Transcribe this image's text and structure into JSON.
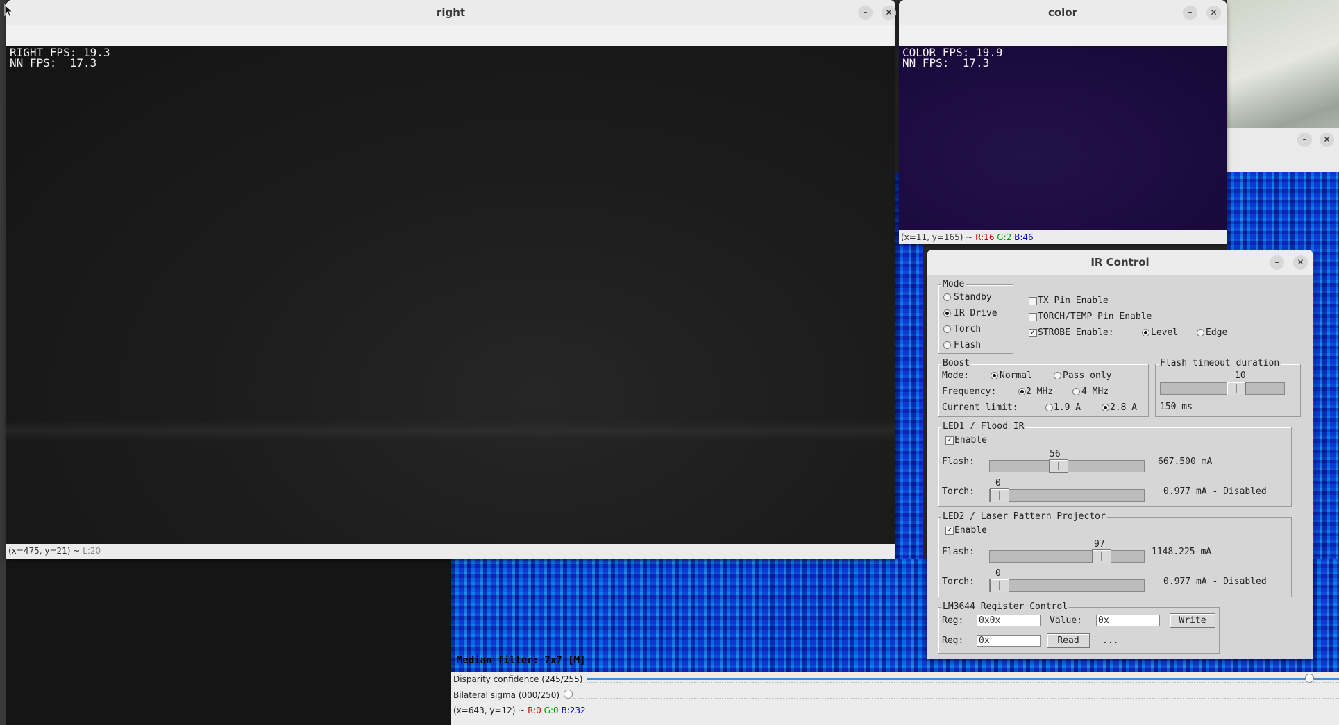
{
  "right_window": {
    "title": "right",
    "overlay_line1": "RIGHT FPS: 19.3",
    "overlay_line2": "NN FPS:  17.3",
    "status_coords": "(x=475, y=21) ~ ",
    "status_value": "L:20"
  },
  "color_window": {
    "title": "color",
    "overlay_line1": "COLOR FPS: 19.9",
    "overlay_line2": "NN FPS:  17.3",
    "status_coords": "(x=11, y=165) ~ ",
    "status_r": "R:16",
    "status_g": "G:2",
    "status_b": "B:46"
  },
  "depth_panel": {
    "median_overlay": "Median filter: 7x7 [M]",
    "disparity_label": "Disparity confidence (245/255)",
    "disparity_value": 245,
    "disparity_max": 255,
    "bilateral_label": "Bilateral sigma (000/250)",
    "bilateral_value": 0,
    "bilateral_max": 250,
    "status_coords": "(x=643, y=12) ~ ",
    "status_r": "R:0",
    "status_g": "G:0",
    "status_b": "B:232"
  },
  "ir_control": {
    "title": "IR Control",
    "mode": {
      "legend": "Mode",
      "options": [
        "Standby",
        "IR Drive",
        "Torch",
        "Flash"
      ],
      "selected": "IR Drive"
    },
    "pins": {
      "tx_pin": {
        "label": "TX Pin Enable",
        "checked": false
      },
      "torch_temp_pin": {
        "label": "TORCH/TEMP Pin Enable",
        "checked": false
      },
      "strobe": {
        "label": "STROBE Enable:",
        "checked": true
      },
      "strobe_level": "Level",
      "strobe_edge": "Edge",
      "strobe_selected": "Level"
    },
    "boost": {
      "legend": "Boost",
      "mode_label": "Mode:",
      "mode_normal": "Normal",
      "mode_pass": "Pass only",
      "freq_label": "Frequency:",
      "freq_2": "2 MHz",
      "freq_4": "4 MHz",
      "current_label": "Current limit:",
      "current_19": "1.9 A",
      "current_28": "2.8 A"
    },
    "flash_timeout": {
      "legend": "Flash timeout duration",
      "slider_value": "10",
      "slider_fraction": 0.63,
      "value_text": "150 ms"
    },
    "led1": {
      "legend": "LED1 / Flood IR",
      "enable_label": "Enable",
      "enabled": true,
      "flash_label": "Flash:",
      "flash_slider_value": "56",
      "flash_fraction": 0.44,
      "flash_text": "667.500 mA",
      "torch_label": "Torch:",
      "torch_slider_value": "0",
      "torch_fraction": 0,
      "torch_text": "0.977 mA - Disabled"
    },
    "led2": {
      "legend": "LED2 / Laser Pattern Projector",
      "enable_label": "Enable",
      "enabled": true,
      "flash_label": "Flash:",
      "flash_slider_value": "97",
      "flash_fraction": 0.76,
      "flash_text": "1148.225 mA",
      "torch_label": "Torch:",
      "torch_slider_value": "0",
      "torch_fraction": 0,
      "torch_text": "0.977 mA - Disabled"
    },
    "register": {
      "legend": "LM3644 Register Control",
      "reg_label": "Reg:",
      "reg_value": "0x0x",
      "value_label": "Value:",
      "value_value": "0x",
      "write_label": "Write",
      "reg2_value": "0x",
      "read_label": "Read",
      "result": "..."
    }
  },
  "icons": {
    "minimize": "minimize-icon",
    "close": "close-icon",
    "mouse_cursor": "mouse-cursor-icon"
  }
}
